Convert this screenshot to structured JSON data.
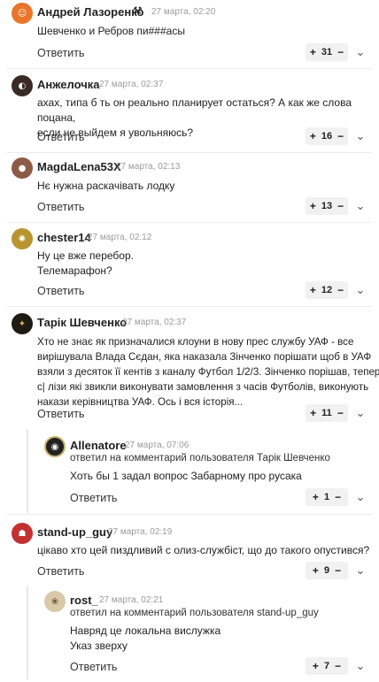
{
  "comments": [
    {
      "author": "Андрей Лазоренко",
      "badge": "⚒",
      "time": "27 марта, 02:20",
      "lines": [
        "Шевченко и Ребров пи###асы"
      ],
      "reply": "Ответить",
      "votes": "31"
    },
    {
      "author": "Анжелочка",
      "time": "27 марта, 02:37",
      "lines": [
        "ахах, типа б   ть он реально планирует остаться? А как же слова поцана,",
        "если не выйдем я увольняюсь?"
      ],
      "reply": "Ответить",
      "votes": "16"
    },
    {
      "author": "MagdaLena53X",
      "time": "27 марта, 02:13",
      "lines": [
        "Нє нужна раскачівать лодку"
      ],
      "reply": "Ответить",
      "votes": "13"
    },
    {
      "author": "chester14",
      "time": "27 марта, 02:12",
      "lines": [
        "Ну це вже перебор.",
        "Телемарафон?"
      ],
      "reply": "Ответить",
      "votes": "12"
    },
    {
      "author": "Тарік Шевченко",
      "time": "27 марта, 02:37",
      "lines": [
        "Хто не знає як призначалися клоуни в нову прес службу УАФ - все",
        "вирішувала Влада Сєдан, яка наказала Зінченко порішати щоб в УАФ",
        "взяли з десяток її кентів з каналу Футбол 1/2/3. Зінченко порішав, тепер",
        "с|        лізи які звикли виконувати замовлення з часів Футболів, виконують",
        "накази керівництва УАФ. Ось і вся історія..."
      ],
      "reply": "Ответить",
      "votes": "11"
    },
    {
      "author": "Allenatore",
      "time": "27 марта, 07:06",
      "reply_to": "ответил на комментарий пользователя Тарік Шевченко",
      "lines": [
        "Хоть бы 1 задал вопрос Забарному про русака"
      ],
      "reply": "Ответить",
      "votes": "1"
    },
    {
      "author": "stand-up_guy",
      "time": "27 марта, 02:19",
      "lines": [
        "цікаво хто цей пиздливий с        олиз-службіст, що до такого опустився?"
      ],
      "reply": "Ответить",
      "votes": "9"
    },
    {
      "author": "rost_",
      "time": "27 марта, 02:21",
      "reply_to": "ответил на комментарий пользователя stand-up_guy",
      "lines": [
        "Навряд це локальна вислужка",
        "Указ зверху"
      ],
      "reply": "Ответить",
      "votes": "7"
    }
  ],
  "colors": {
    "avatar0": "#e8752a",
    "avatar1": "#3a2a26",
    "avatar2": "#8c5a45",
    "avatar3": "#b8952e",
    "avatar4": "#1e1a14",
    "avatar5": "#222222",
    "avatar6": "#c23030",
    "avatar7": "#d9c9a8"
  }
}
